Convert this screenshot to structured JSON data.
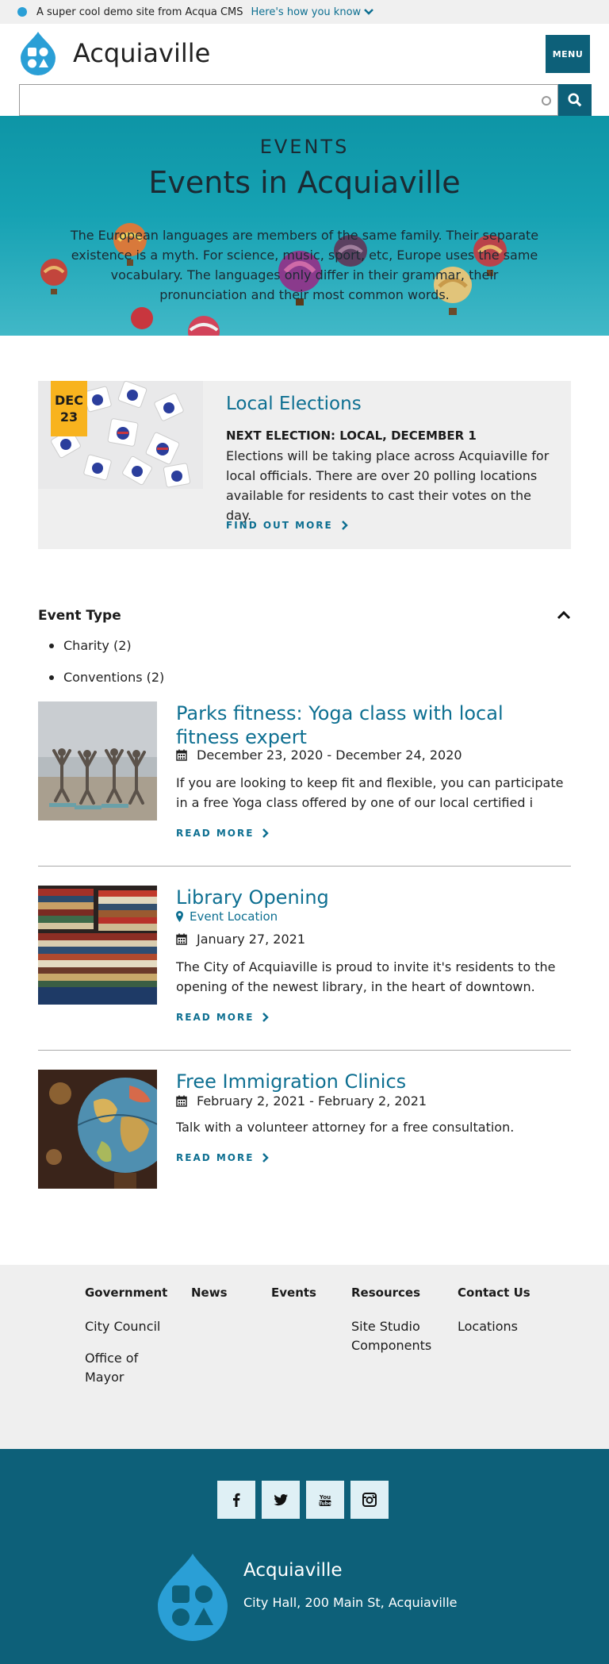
{
  "banner": {
    "text": "A super cool demo site from Acqua CMS",
    "link": "Here's how you know"
  },
  "site": {
    "name": "Acquiaville"
  },
  "header": {
    "menu_label": "MENU",
    "search_placeholder": ""
  },
  "hero": {
    "eyebrow": "EVENTS",
    "title": "Events in Acquiaville",
    "body": "The European languages are members of the same family. Their separate existence is a myth. For science, music, sport, etc, Europe uses the same vocabulary. The languages only differ in their grammar, their pronunciation and their most common words."
  },
  "featured": {
    "date_month": "DEC",
    "date_day": "23",
    "title": "Local Elections",
    "subtitle": "NEXT ELECTION: LOCAL, DECEMBER 1",
    "description": "Elections will be taking place across Acquiaville for local officials. There are over 20 polling locations available for residents to cast their votes on the day.",
    "link": "FIND OUT MORE"
  },
  "facet": {
    "title": "Event Type",
    "items": [
      "Charity (2)",
      "Conventions (2)"
    ]
  },
  "events": [
    {
      "title": "Parks fitness: Yoga class with local fitness expert",
      "date": "December 23, 2020 - December 24, 2020",
      "description": "If you are looking to keep fit and flexible, you can participate in a free Yoga class offered by one of our local certified i",
      "link": "READ MORE"
    },
    {
      "title": "Library Opening",
      "location": "Event Location",
      "date": "January 27, 2021",
      "description": "The City of Acquiaville is proud to invite it's residents to the opening of the newest library, in the heart of downtown.",
      "link": "READ MORE"
    },
    {
      "title": "Free Immigration Clinics",
      "date": "February 2, 2021 - February 2, 2021",
      "description": "Talk with a volunteer attorney for a free consultation.",
      "link": "READ MORE"
    }
  ],
  "footer_nav": [
    {
      "heading": "Government",
      "links": [
        "City Council",
        "Office of Mayor"
      ]
    },
    {
      "heading": "News",
      "links": []
    },
    {
      "heading": "Events",
      "links": []
    },
    {
      "heading": "Resources",
      "links": [
        "Site Studio Components"
      ]
    },
    {
      "heading": "Contact Us",
      "links": [
        "Locations"
      ]
    }
  ],
  "footer": {
    "social": [
      "facebook-icon",
      "twitter-icon",
      "youtube-icon",
      "instagram-icon"
    ],
    "name": "Acquiaville",
    "address": "City Hall, 200 Main St, Acquiaville"
  },
  "colors": {
    "brand_teal": "#0d6079",
    "link_blue": "#0d6f91",
    "accent_yellow": "#f8b31e",
    "logo_blue": "#2a9fd6"
  }
}
